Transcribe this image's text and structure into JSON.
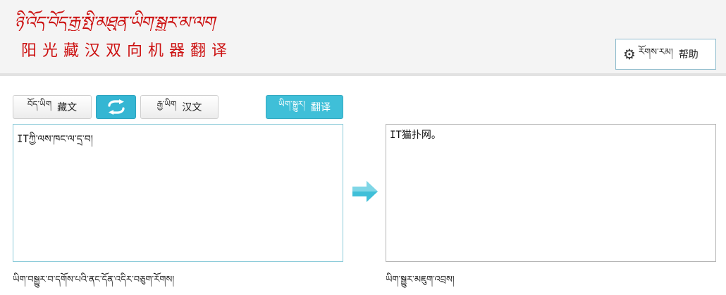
{
  "header": {
    "logo_tibetan": "ཉི་འོད་བོད་རྒྱ་སྤྱི་མཐུན་ཡིག་སྒྱུར་མ་ལག",
    "logo_chinese": "阳光藏汉双向机器翻译",
    "help": {
      "tibetan": "རོགས་རམ།",
      "chinese": "帮助",
      "icon": "gear-icon"
    }
  },
  "toolbar": {
    "source_lang": {
      "tibetan": "བོད་ཡིག",
      "chinese": "藏文"
    },
    "swap_icon": "swap-icon",
    "target_lang": {
      "tibetan": "རྒྱ་ཡིག",
      "chinese": "汉文"
    },
    "translate": {
      "tibetan": "ཡིག་སྒྱུར།",
      "chinese": "翻译"
    }
  },
  "source": {
    "value": "ITཀྱི་ལས་ཁང་ལ་དྲ་བ།",
    "hint": "ཡིག་བསྒྱུར་བ་དགོས་པའི་ནང་དོན་འདིར་བཅུག་རོགས།"
  },
  "target": {
    "value": "IT猫扑网。",
    "hint": "ཡིག་སྒྱུར་མཇུག་འབྲས།"
  },
  "colors": {
    "logo": "#cc1111",
    "accent": "#35b6d3",
    "border": "#8ccbd9",
    "header_bg": "#f4f4f4"
  }
}
